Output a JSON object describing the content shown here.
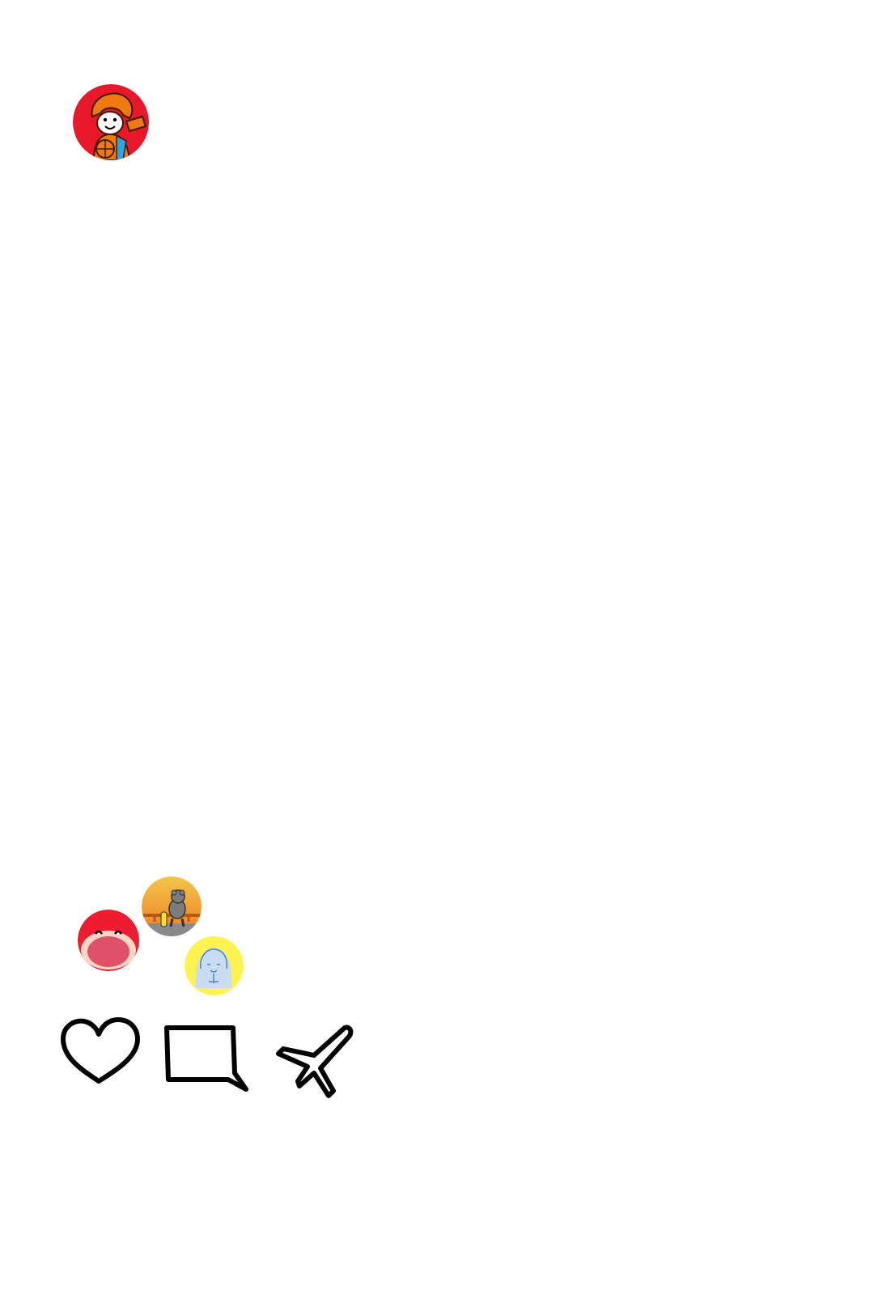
{
  "post": {
    "author_avatar": {
      "icon": "cartoon-character-avatar-icon",
      "bg_color": "#e8182a",
      "accent_color": "#f07a12"
    },
    "reactors": [
      {
        "icon": "laughing-face-avatar-icon",
        "bg_color": "#ee1c30"
      },
      {
        "icon": "sunset-figure-avatar-icon",
        "bg_color": "#f2b233"
      },
      {
        "icon": "blue-doodle-avatar-icon",
        "bg_color": "#fff352"
      }
    ]
  },
  "actions": {
    "like": {
      "icon": "heart-icon"
    },
    "comment": {
      "icon": "comment-bubble-icon"
    },
    "share": {
      "icon": "paper-plane-icon"
    }
  },
  "colors": {
    "background": "#ffffff",
    "icon_stroke": "#000000"
  }
}
